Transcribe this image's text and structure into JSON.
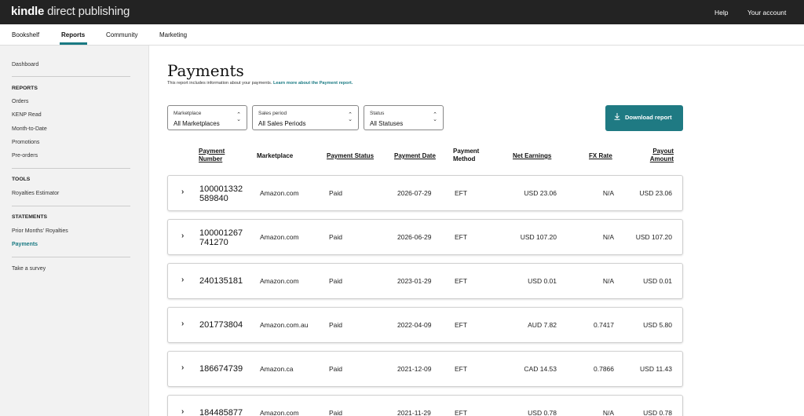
{
  "header": {
    "logo_bold": "kindle",
    "logo_rest": " direct publishing",
    "help": "Help",
    "account": "Your account"
  },
  "nav": {
    "tabs": [
      "Bookshelf",
      "Reports",
      "Community",
      "Marketing"
    ],
    "active": "Reports"
  },
  "sidebar": {
    "dashboard": "Dashboard",
    "reports_head": "REPORTS",
    "reports": [
      "Orders",
      "KENP Read",
      "Month-to-Date",
      "Promotions",
      "Pre-orders"
    ],
    "tools_head": "TOOLS",
    "tools": [
      "Royalties Estimator"
    ],
    "statements_head": "STATEMENTS",
    "statements": [
      "Prior Months' Royalties",
      "Payments"
    ],
    "survey": "Take a survey"
  },
  "page": {
    "title": "Payments",
    "subtitle": "This report includes information about your payments.",
    "subtitle_link": "Learn more about the Payment report."
  },
  "filters": {
    "marketplace": {
      "label": "Marketplace",
      "value": "All Marketplaces"
    },
    "sales_period": {
      "label": "Sales period",
      "value": "All Sales Periods"
    },
    "status": {
      "label": "Status",
      "value": "All Statuses"
    }
  },
  "download_label": "Download report",
  "table": {
    "headers": {
      "payment_number": [
        "Payment",
        "Number"
      ],
      "marketplace": "Marketplace",
      "payment_status": "Payment Status",
      "payment_date": "Payment Date",
      "payment_method": [
        "Payment",
        "Method"
      ],
      "net_earnings": "Net Earnings",
      "fx_rate": "FX Rate",
      "payout_amount": [
        "Payout",
        "Amount"
      ]
    },
    "rows": [
      {
        "number": [
          "100001332",
          "589840"
        ],
        "marketplace": "Amazon.com",
        "status": "Paid",
        "date": "2026-07-29",
        "method": "EFT",
        "net": "USD 23.06",
        "fx": "N/A",
        "payout": "USD 23.06"
      },
      {
        "number": [
          "100001267",
          "741270"
        ],
        "marketplace": "Amazon.com",
        "status": "Paid",
        "date": "2026-06-29",
        "method": "EFT",
        "net": "USD 107.20",
        "fx": "N/A",
        "payout": "USD 107.20"
      },
      {
        "number": [
          "240135181"
        ],
        "marketplace": "Amazon.com",
        "status": "Paid",
        "date": "2023-01-29",
        "method": "EFT",
        "net": "USD 0.01",
        "fx": "N/A",
        "payout": "USD 0.01"
      },
      {
        "number": [
          "201773804"
        ],
        "marketplace": "Amazon.com.au",
        "status": "Paid",
        "date": "2022-04-09",
        "method": "EFT",
        "net": "AUD 7.82",
        "fx": "0.7417",
        "payout": "USD 5.80"
      },
      {
        "number": [
          "186674739"
        ],
        "marketplace": "Amazon.ca",
        "status": "Paid",
        "date": "2021-12-09",
        "method": "EFT",
        "net": "CAD 14.53",
        "fx": "0.7866",
        "payout": "USD 11.43"
      },
      {
        "number": [
          "184485877"
        ],
        "marketplace": "Amazon.com",
        "status": "Paid",
        "date": "2021-11-29",
        "method": "EFT",
        "net": "USD 0.78",
        "fx": "N/A",
        "payout": "USD 0.78"
      }
    ]
  },
  "colors": {
    "accent": "#1f7a83",
    "topbar": "#232323",
    "sidebar": "#f2f2f2"
  }
}
